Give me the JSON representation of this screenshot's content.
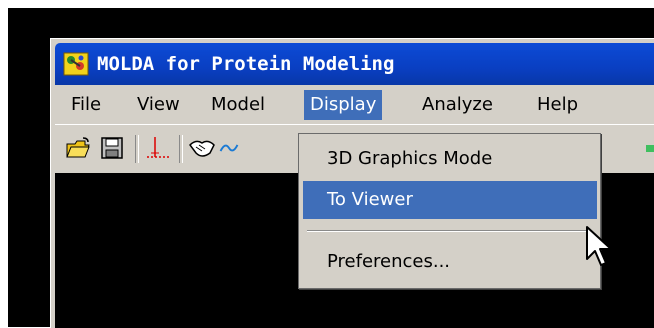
{
  "window": {
    "title": "MOLDA for Protein Modeling"
  },
  "menubar": {
    "items": [
      {
        "label": "File"
      },
      {
        "label": "View"
      },
      {
        "label": "Model"
      },
      {
        "label": "Display"
      },
      {
        "label": "Analyze"
      },
      {
        "label": "Help"
      }
    ],
    "active": "Display"
  },
  "toolbar": {
    "buttons": [
      "open-folder-icon",
      "save-disk-icon",
      "axes-icon",
      "handshake-icon",
      "wave-icon"
    ]
  },
  "display_menu": {
    "items": [
      {
        "label": "3D Graphics Mode"
      },
      {
        "label": "To Viewer"
      },
      {
        "label": "Preferences..."
      }
    ],
    "highlighted": "To Viewer"
  },
  "colors": {
    "titlebar": "#0a3fc2",
    "highlight": "#3f6eb9",
    "chrome": "#d4d0c8",
    "canvas": "#000000"
  }
}
